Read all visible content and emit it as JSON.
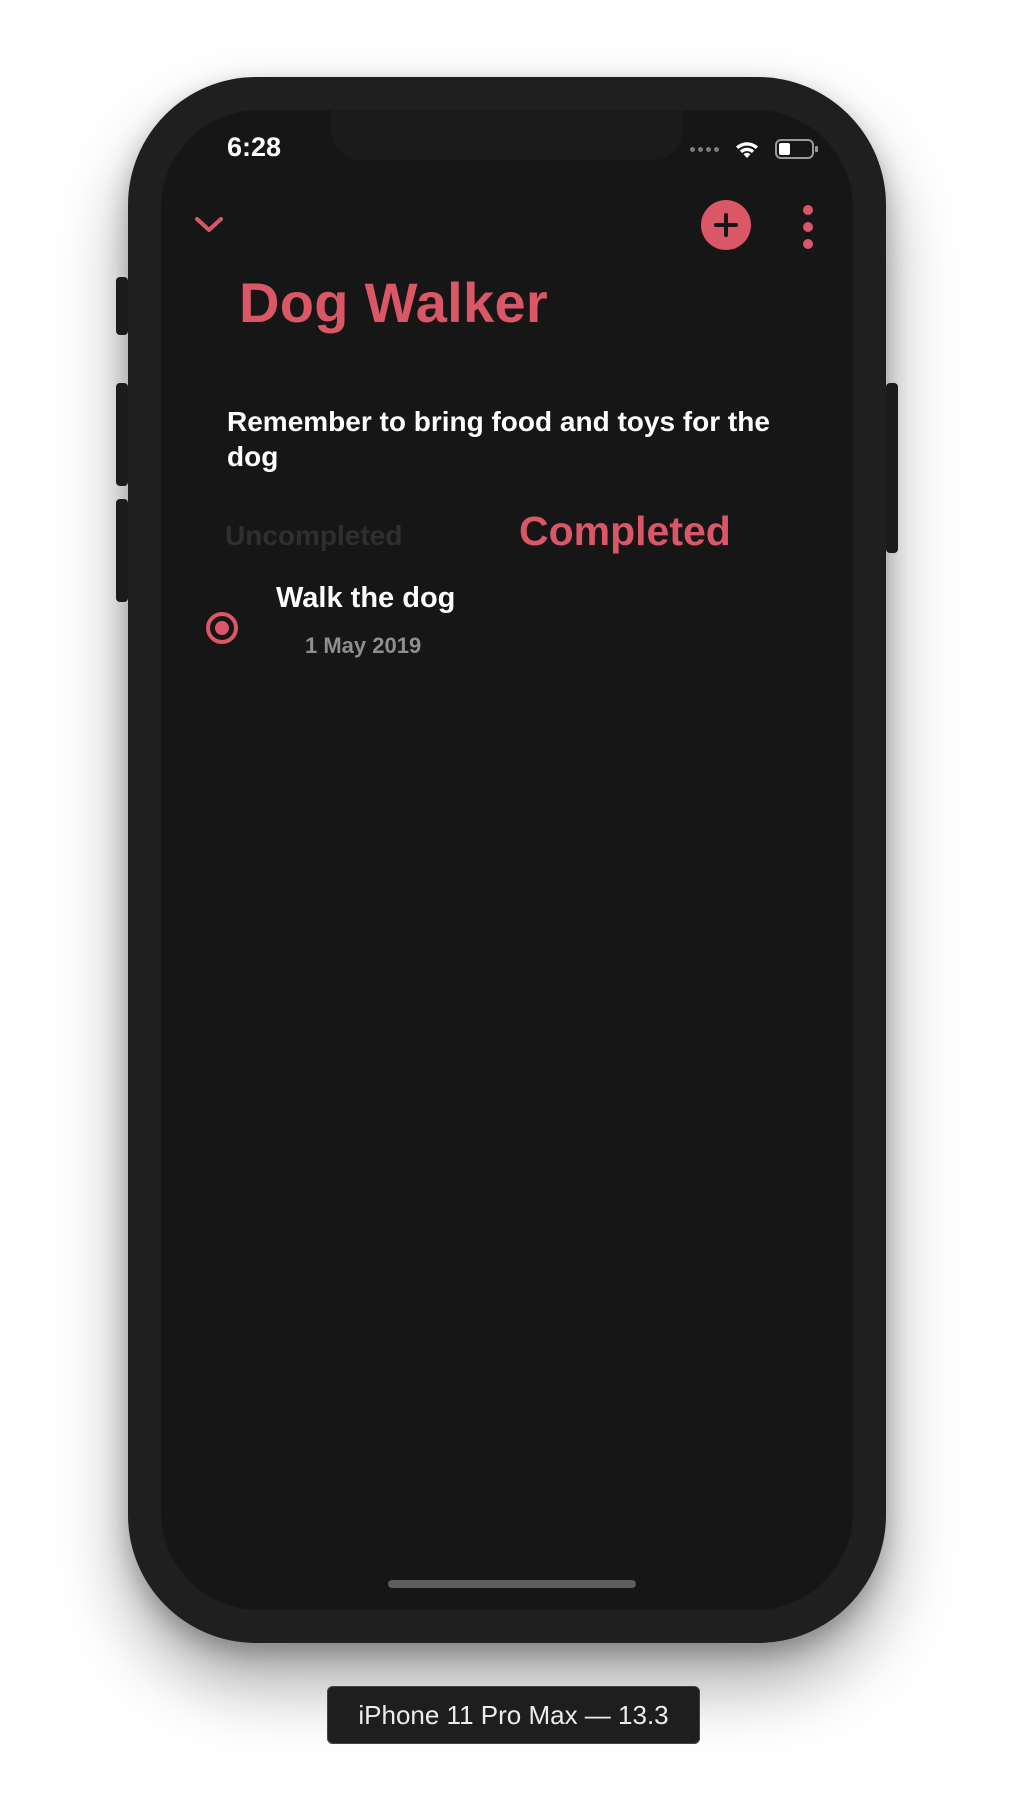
{
  "status_bar": {
    "time": "6:28"
  },
  "nav": {
    "back_icon": "chevron-down-icon",
    "add_icon": "plus-circle-icon",
    "more_icon": "vertical-ellipsis-icon"
  },
  "list": {
    "title": "Dog Walker",
    "description": "Remember to bring food and toys for the dog"
  },
  "tabs": {
    "uncompleted": "Uncompleted",
    "completed": "Completed",
    "selected": "Completed"
  },
  "tasks": [
    {
      "title": "Walk the dog",
      "date": "1 May 2019",
      "completed": true
    }
  ],
  "device_label": "iPhone 11 Pro Max — 13.3",
  "colors": {
    "accent": "#d95767",
    "background": "#161616",
    "text": "#ffffff",
    "muted": "#8e8e8e",
    "inactive_tab": "#2f2f2f"
  }
}
